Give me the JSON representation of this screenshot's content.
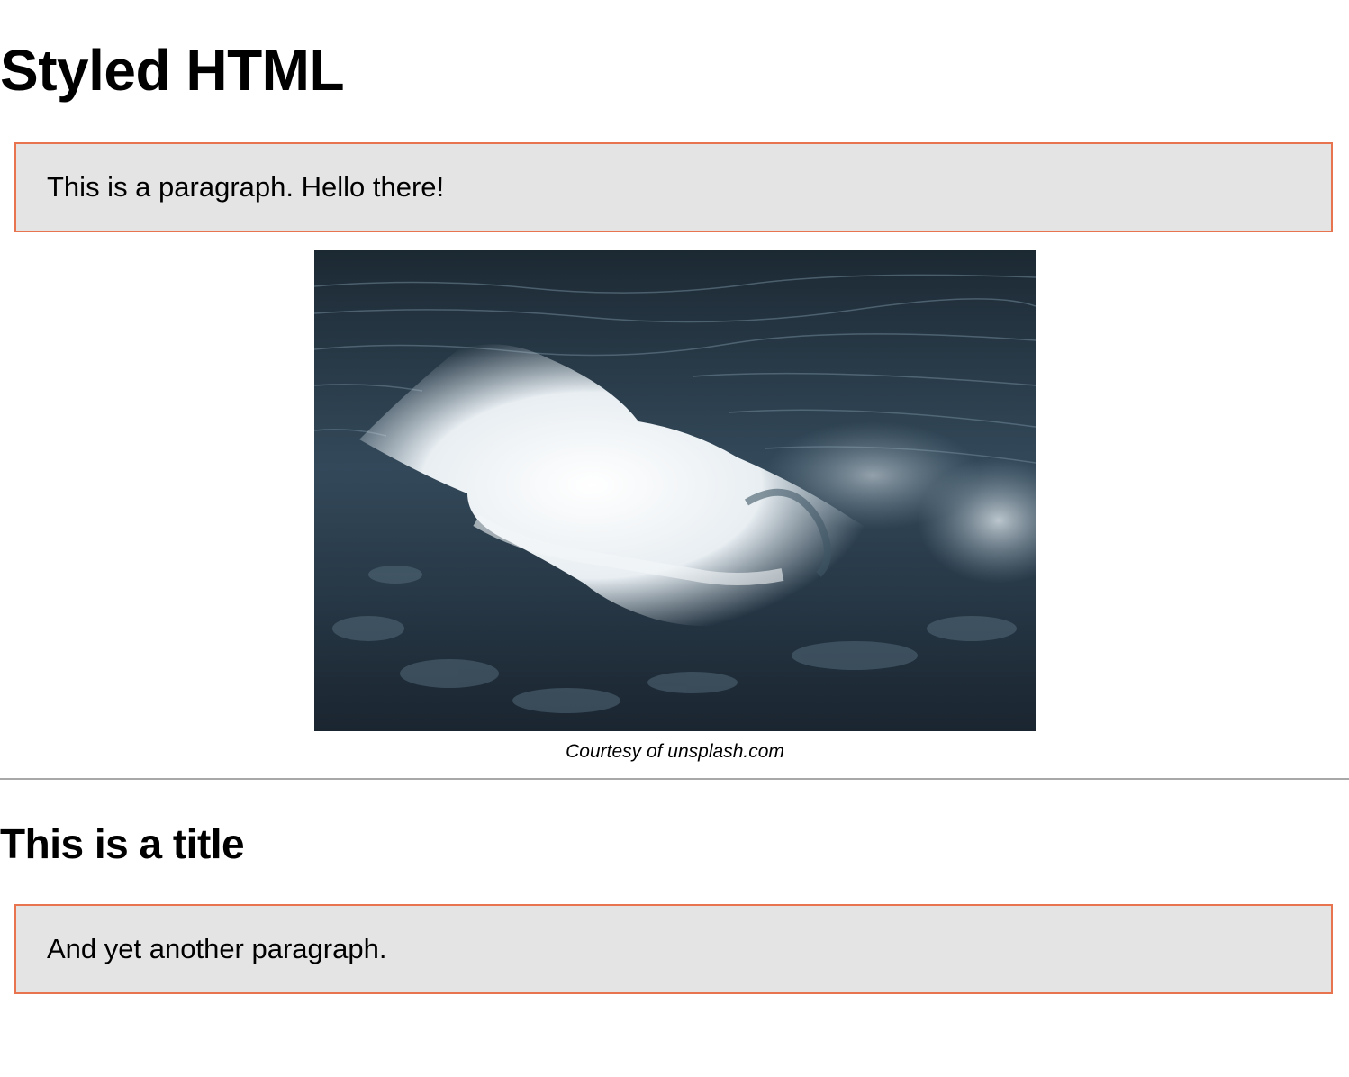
{
  "page": {
    "heading": "Styled HTML",
    "paragraph_1": "This is a paragraph. Hello there!",
    "figure": {
      "image_subject": "ocean-wave-photo",
      "caption": "Courtesy of unsplash.com"
    },
    "section_title": "This is a title",
    "paragraph_2": "And yet another paragraph."
  },
  "colors": {
    "box_border": "#e8744f",
    "box_background": "#e4e4e4",
    "divider": "#a8a8a8"
  }
}
